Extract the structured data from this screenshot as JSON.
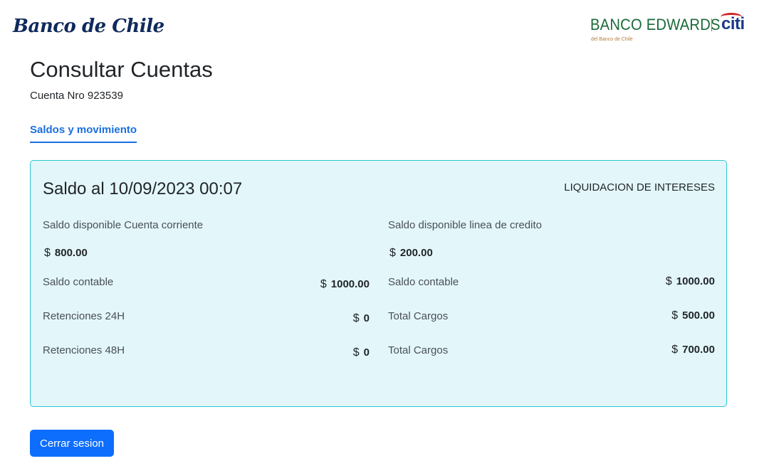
{
  "header": {
    "bank_logo_left": "Banco de Chile",
    "bank_logo_right": {
      "name": "BANCO EDWARDS",
      "brand": "citi",
      "subtitle": "del Banco de Chile"
    }
  },
  "page": {
    "title": "Consultar Cuentas",
    "account_line": "Cuenta Nro 923539",
    "tab": "Saldos y movimiento"
  },
  "card": {
    "title": "Saldo al 10/09/2023 00:07",
    "action": "LIQUIDACION DE INTERESES",
    "currency": "$",
    "left": {
      "available_label": "Saldo disponible Cuenta corriente",
      "available_value": "800.00",
      "rows": [
        {
          "label": "Saldo contable",
          "value": "1000.00"
        },
        {
          "label": "Retenciones 24H",
          "value": "0"
        },
        {
          "label": "Retenciones 48H",
          "value": "0"
        }
      ]
    },
    "right": {
      "available_label": "Saldo disponible linea de credito",
      "available_value": "200.00",
      "rows": [
        {
          "label": "Saldo contable",
          "value": "1000.00"
        },
        {
          "label": "Total Cargos",
          "value": "500.00"
        },
        {
          "label": "Total Cargos",
          "value": "700.00"
        }
      ]
    }
  },
  "footer": {
    "logout_label": "Cerrar sesion"
  },
  "colors": {
    "primary": "#0d6efd",
    "tab_accent": "#1a6fe0",
    "card_bg": "#e3f7fb",
    "card_border": "#2cc7d6"
  }
}
